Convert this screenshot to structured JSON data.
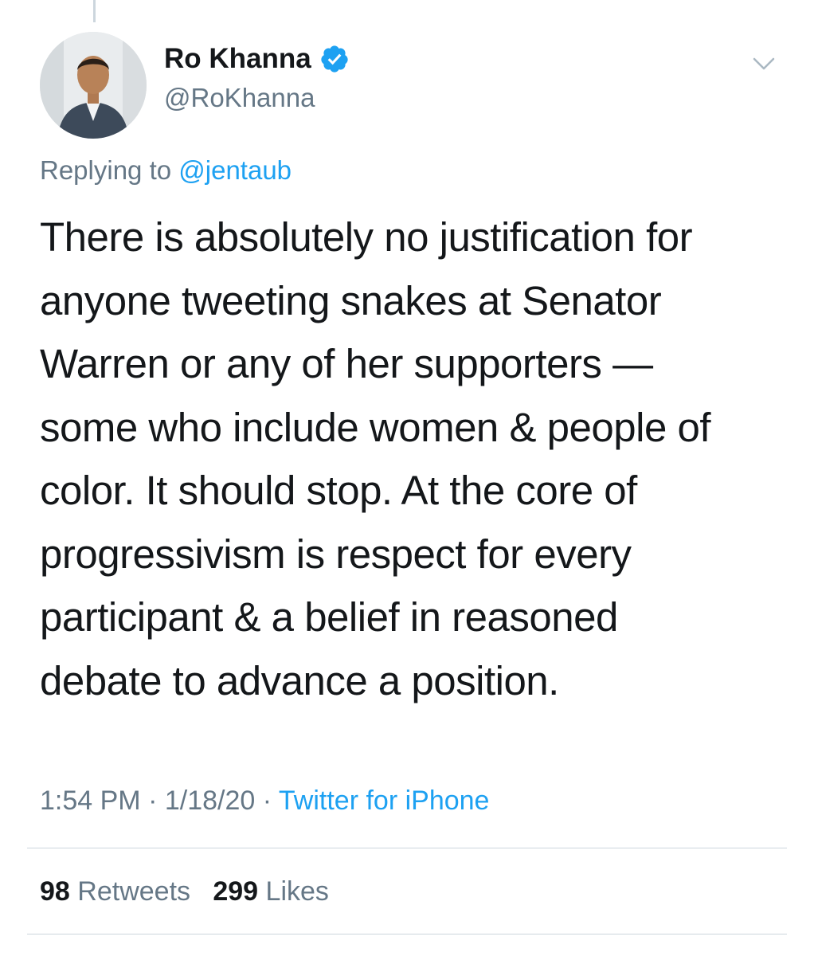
{
  "author": {
    "display_name": "Ro Khanna",
    "handle": "@RoKhanna",
    "verified": true
  },
  "reply": {
    "prefix": "Replying to ",
    "mention": "@jentaub"
  },
  "tweet": {
    "text": "There is absolutely no justification for\nanyone tweeting snakes at Senator\nWarren or any of her supporters —\nsome who include women & people of\ncolor. It should stop. At the core of\nprogressivism is respect for every\nparticipant & a belief in reasoned\ndebate to advance a position."
  },
  "meta": {
    "time": "1:54 PM",
    "separator": " · ",
    "date": "1/18/20",
    "source": "Twitter for iPhone"
  },
  "stats": {
    "retweets_count": "98",
    "retweets_label": "Retweets",
    "likes_count": "299",
    "likes_label": "Likes"
  },
  "colors": {
    "accent": "#1da1f2",
    "secondary_text": "#657786",
    "primary_text": "#14171a",
    "divider": "#ccd6dd"
  },
  "icons": {
    "verified": "verified-badge-icon",
    "menu": "chevron-down-icon"
  }
}
